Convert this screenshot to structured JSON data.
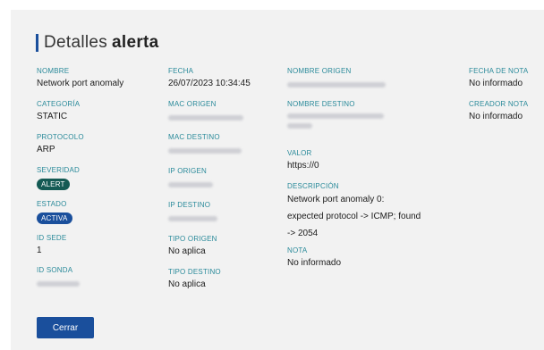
{
  "title": {
    "light": "Detalles",
    "bold": "alerta"
  },
  "col1": {
    "nombre": {
      "label": "NOMBRE",
      "value": "Network port anomaly"
    },
    "categoria": {
      "label": "CATEGORÍA",
      "value": "STATIC"
    },
    "protocolo": {
      "label": "PROTOCOLO",
      "value": "ARP"
    },
    "severidad": {
      "label": "SEVERIDAD",
      "value": "ALERT"
    },
    "estado": {
      "label": "ESTADO",
      "value": "ACTIVA"
    },
    "id_sede": {
      "label": "ID SEDE",
      "value": "1"
    },
    "id_sonda": {
      "label": "ID SONDA"
    }
  },
  "col2": {
    "fecha": {
      "label": "FECHA",
      "value": "26/07/2023 10:34:45"
    },
    "mac_origen": {
      "label": "MAC ORIGEN"
    },
    "mac_destino": {
      "label": "MAC DESTINO"
    },
    "ip_origen": {
      "label": "IP ORIGEN"
    },
    "ip_destino": {
      "label": "IP DESTINO"
    },
    "tipo_origen": {
      "label": "TIPO ORIGEN",
      "value": "No aplica"
    },
    "tipo_destino": {
      "label": "TIPO DESTINO",
      "value": "No aplica"
    }
  },
  "col3": {
    "nombre_origen": {
      "label": "NOMBRE ORIGEN"
    },
    "nombre_destino": {
      "label": "NOMBRE DESTINO"
    },
    "valor": {
      "label": "VALOR",
      "value": "https://0"
    },
    "descripcion": {
      "label": "DESCRIPCIÓN",
      "lines": [
        "Network port anomaly 0:",
        "expected protocol -> ICMP; found",
        "-> 2054"
      ]
    },
    "nota": {
      "label": "NOTA",
      "value": "No informado"
    }
  },
  "col4": {
    "fecha_nota": {
      "label": "FECHA DE NOTA",
      "value": "No informado"
    },
    "creador_nota": {
      "label": "CREADOR NOTA",
      "value": "No informado"
    }
  },
  "buttons": {
    "close": "Cerrar"
  },
  "colors": {
    "accent": "#1a4f9c",
    "label": "#2a8a9a",
    "severity_badge": "#145a54",
    "panel": "#f2f2f2"
  }
}
